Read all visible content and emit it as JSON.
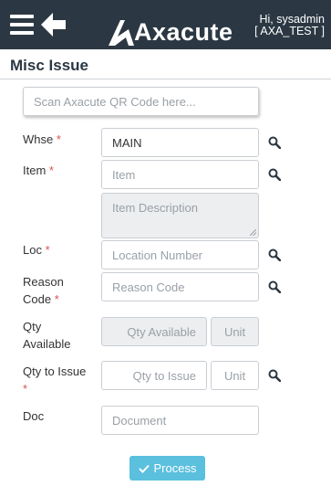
{
  "header": {
    "brand": "Axacute",
    "user_greeting": "Hi, sysadmin",
    "site": "[ AXA_TEST ]"
  },
  "page": {
    "title": "Misc Issue"
  },
  "scan": {
    "placeholder": "Scan Axacute QR Code here..."
  },
  "form": {
    "whse": {
      "label": "Whse",
      "value": "MAIN"
    },
    "item": {
      "label": "Item",
      "placeholder": "Item",
      "description_placeholder": "Item Description"
    },
    "loc": {
      "label": "Loc",
      "placeholder": "Location Number"
    },
    "reason": {
      "label_line1": "Reason",
      "label_line2": "Code",
      "placeholder": "Reason Code"
    },
    "qty_available": {
      "label_line1": "Qty",
      "label_line2": "Available",
      "placeholder": "Qty Available",
      "unit_placeholder": "Unit"
    },
    "qty_to_issue": {
      "label": "Qty to Issue",
      "placeholder": "Qty to Issue",
      "unit_placeholder": "Unit"
    },
    "doc": {
      "label": "Doc",
      "placeholder": "Document"
    },
    "required_mark": "*"
  },
  "actions": {
    "process_label": "Process"
  },
  "icons": {
    "menu": "hamburger-menu-icon",
    "back": "back-arrow-icon",
    "search": "search-icon",
    "process": "check-icon"
  },
  "colors": {
    "header_bg": "#2b3843",
    "required": "#d9534f",
    "process_button": "#5bc0de"
  }
}
